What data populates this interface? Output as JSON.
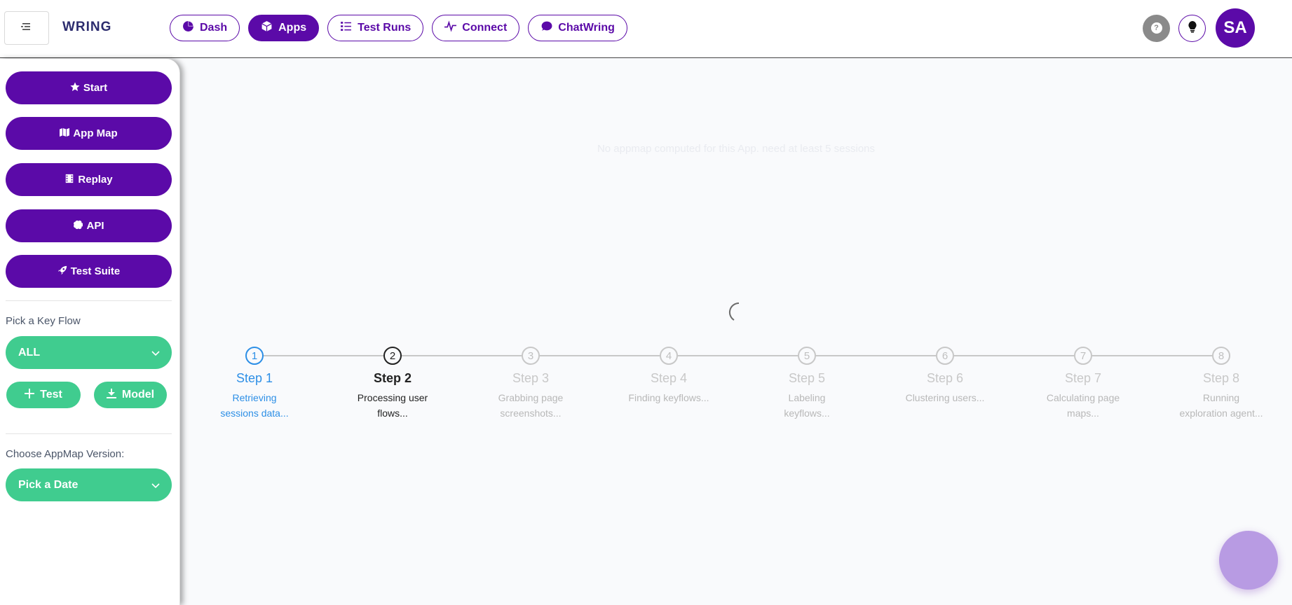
{
  "header": {
    "brand": "WRING",
    "nav": [
      {
        "label": "Dash",
        "icon": "pie-chart-icon",
        "active": false
      },
      {
        "label": "Apps",
        "icon": "cube-icon",
        "active": true
      },
      {
        "label": "Test Runs",
        "icon": "list-icon",
        "active": false
      },
      {
        "label": "Connect",
        "icon": "pulse-icon",
        "active": false
      },
      {
        "label": "ChatWring",
        "icon": "chat-icon",
        "active": false
      }
    ],
    "help_glyph": "?",
    "avatar_initials": "SA"
  },
  "sidebar": {
    "buttons": [
      {
        "label": "Start",
        "icon": "star-icon"
      },
      {
        "label": "App Map",
        "icon": "map-icon"
      },
      {
        "label": "Replay",
        "icon": "film-icon"
      },
      {
        "label": "API",
        "icon": "brain-icon"
      },
      {
        "label": "Test Suite",
        "icon": "rocket-icon"
      }
    ],
    "key_flow_label": "Pick a Key Flow",
    "key_flow_value": "ALL",
    "test_button": "Test",
    "model_button": "Model",
    "version_label": "Choose AppMap Version:",
    "version_value": "Pick a Date"
  },
  "main": {
    "message": "No appmap computed for this App. need at least 5 sessions",
    "steps": [
      {
        "num": "1",
        "title": "Step 1",
        "desc": "Retrieving sessions data...",
        "state": "done"
      },
      {
        "num": "2",
        "title": "Step 2",
        "desc": "Processing user flows...",
        "state": "current"
      },
      {
        "num": "3",
        "title": "Step 3",
        "desc": "Grabbing page screenshots...",
        "state": "pending"
      },
      {
        "num": "4",
        "title": "Step 4",
        "desc": "Finding keyflows...",
        "state": "pending"
      },
      {
        "num": "5",
        "title": "Step 5",
        "desc": "Labeling keyflows...",
        "state": "pending"
      },
      {
        "num": "6",
        "title": "Step 6",
        "desc": "Clustering users...",
        "state": "pending"
      },
      {
        "num": "7",
        "title": "Step 7",
        "desc": "Calculating page maps...",
        "state": "pending"
      },
      {
        "num": "8",
        "title": "Step 8",
        "desc": "Running exploration agent...",
        "state": "pending"
      }
    ]
  },
  "colors": {
    "primary": "#5b0aa8",
    "green": "#40cc8f",
    "step_done": "#2d8fe6"
  }
}
